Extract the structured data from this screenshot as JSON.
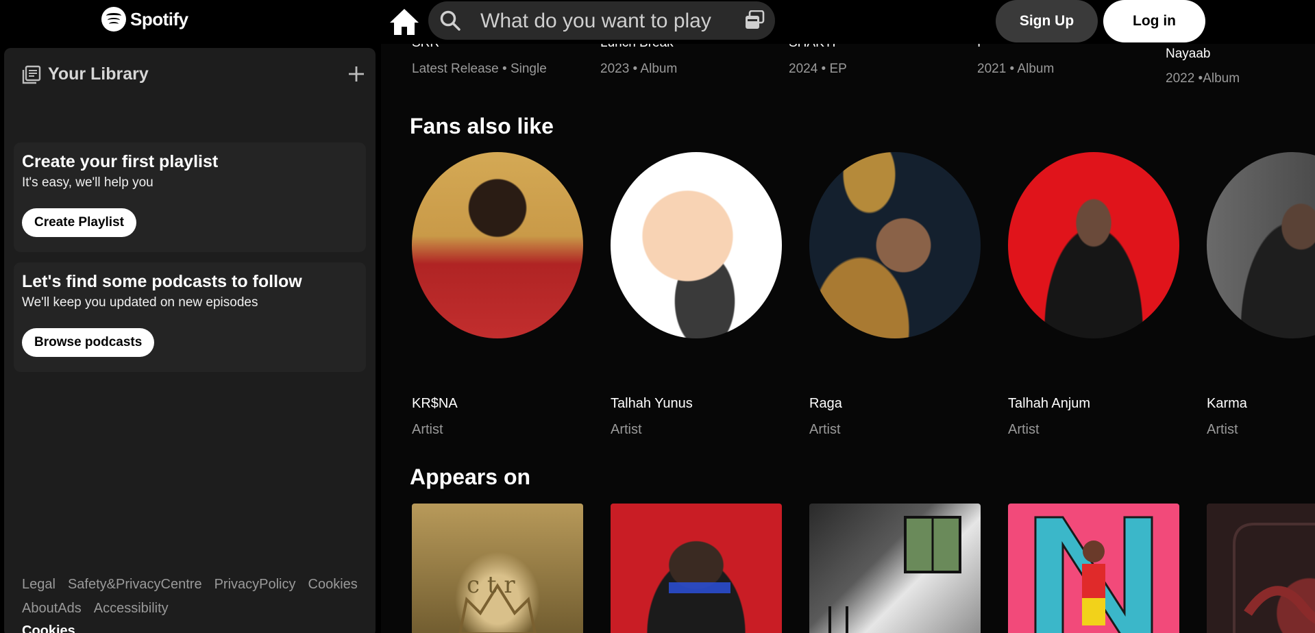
{
  "header": {
    "logo_text": "Spotify",
    "search_placeholder": "What do you want to play",
    "signup_label": "Sign Up",
    "login_label": "Log in"
  },
  "sidebar": {
    "library_title": "Your Library",
    "playlist_card": {
      "title": "Create your first playlist",
      "subtitle": "It's easy, we'll help you",
      "button": "Create Playlist"
    },
    "podcast_card": {
      "title": "Let's find some podcasts to follow",
      "subtitle": "We'll keep you updated on new episodes",
      "button": "Browse podcasts"
    },
    "legal_links": [
      "Legal",
      "Safety&PrivacyCentre",
      "PrivacyPolicy",
      "Cookies",
      "AboutAds",
      "Accessibility"
    ],
    "cookies_label": "Cookies"
  },
  "releases": [
    {
      "title": "SRR",
      "meta": "Latest Release • Single"
    },
    {
      "title": "Lunch Break",
      "meta": "2023 • Album"
    },
    {
      "title": "SHAKTI",
      "meta": "2024 • EP"
    },
    {
      "title": "I",
      "meta": "2021 • Album"
    },
    {
      "title": "Nayaab",
      "meta": "2022 •Album"
    }
  ],
  "fans_also_like": {
    "title": "Fans also like",
    "artists": [
      {
        "name": "KR$NA",
        "type": "Artist",
        "colors": [
          "#d4a955",
          "#c22e2e"
        ]
      },
      {
        "name": "Talhah Yunus",
        "type": "Artist",
        "colors": [
          "#ffffff",
          "#f8d3b4"
        ]
      },
      {
        "name": "Raga",
        "type": "Artist",
        "colors": [
          "#14202e",
          "#b58a3a"
        ]
      },
      {
        "name": "Talhah Anjum",
        "type": "Artist",
        "colors": [
          "#e0141b",
          "#161616"
        ]
      },
      {
        "name": "Karma",
        "type": "Artist",
        "colors": [
          "#4a4a4a",
          "#1e1e1e"
        ]
      }
    ]
  },
  "appears_on": {
    "title": "Appears on",
    "albums": [
      {
        "colors": [
          "#b89a5a",
          "#6e5a2e"
        ],
        "icon": "crown-art"
      },
      {
        "colors": [
          "#c91d25",
          "#1b1b1b"
        ],
        "icon": "portrait-art"
      },
      {
        "colors": [
          "#e6e6e6",
          "#2a2a2a"
        ],
        "icon": "window-light-art"
      },
      {
        "colors": [
          "#f24a7a",
          "#3bb7c9"
        ],
        "icon": "colorful-art"
      },
      {
        "colors": [
          "#2b1c1c",
          "#7a2a2a"
        ],
        "icon": "serpent-art"
      }
    ]
  }
}
